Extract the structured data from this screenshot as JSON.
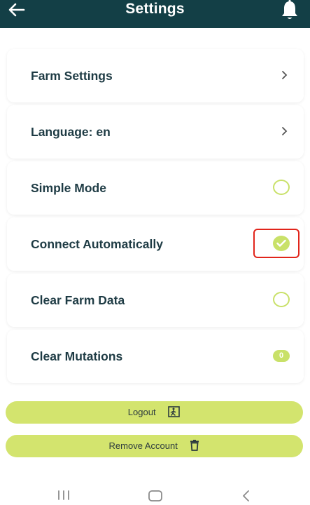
{
  "header": {
    "title": "Settings",
    "back_icon": "arrow-left-icon",
    "notifications_icon": "bell-icon",
    "background": "#133f46"
  },
  "settings": {
    "farm_settings": {
      "label": "Farm Settings",
      "icon": "chevron-right-icon"
    },
    "language": {
      "label": "Language: en",
      "icon": "chevron-right-icon"
    },
    "simple_mode": {
      "label": "Simple Mode",
      "checked": false
    },
    "connect_automatically": {
      "label": "Connect Automatically",
      "checked": true
    },
    "clear_farm_data": {
      "label": "Clear Farm Data",
      "checked": false
    },
    "clear_mutations": {
      "label": "Clear Mutations",
      "count": "0"
    }
  },
  "buttons": {
    "logout": {
      "label": "Logout",
      "icon": "exit-door-icon"
    },
    "remove_account": {
      "label": "Remove Account",
      "icon": "trash-icon"
    }
  },
  "accent_color": "#c9e169",
  "highlight_color": "#e1251b",
  "android_nav": {
    "recents_icon": "recents-icon",
    "home_icon": "home-icon",
    "back_icon": "back-chevron-icon"
  }
}
